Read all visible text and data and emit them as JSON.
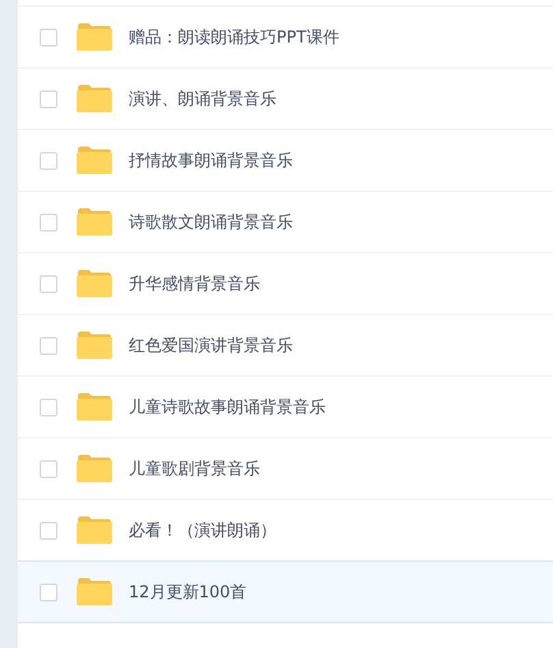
{
  "files": [
    {
      "name": "赠品：朗读朗诵技巧PPT课件",
      "checked": false,
      "hovered": false
    },
    {
      "name": "演讲、朗诵背景音乐",
      "checked": false,
      "hovered": false
    },
    {
      "name": "抒情故事朗诵背景音乐",
      "checked": false,
      "hovered": false
    },
    {
      "name": "诗歌散文朗诵背景音乐",
      "checked": false,
      "hovered": false
    },
    {
      "name": "升华感情背景音乐",
      "checked": false,
      "hovered": false
    },
    {
      "name": "红色爱国演讲背景音乐",
      "checked": false,
      "hovered": false
    },
    {
      "name": "儿童诗歌故事朗诵背景音乐",
      "checked": false,
      "hovered": false
    },
    {
      "name": "儿童歌剧背景音乐",
      "checked": false,
      "hovered": false
    },
    {
      "name": "必看！（演讲朗诵）",
      "checked": false,
      "hovered": false
    },
    {
      "name": "12月更新100首",
      "checked": false,
      "hovered": true
    }
  ]
}
